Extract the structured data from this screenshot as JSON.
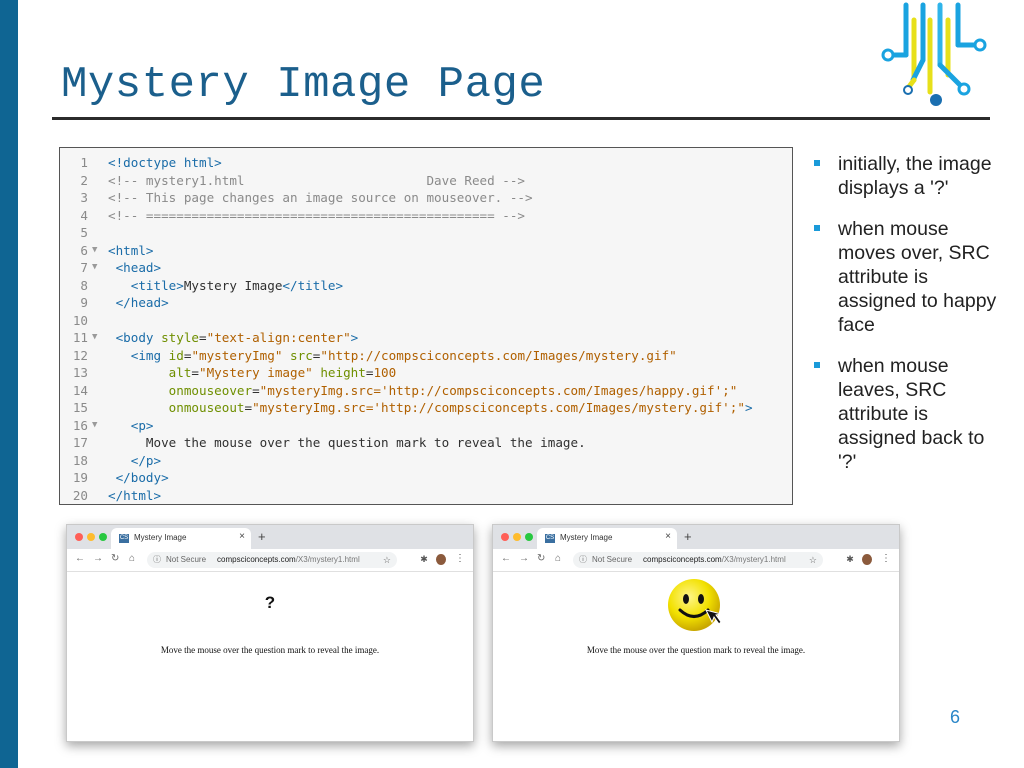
{
  "slide": {
    "title": "Mystery Image Page",
    "page_number": "6"
  },
  "code": {
    "lines": [
      {
        "n": "1",
        "fold": "",
        "parts": [
          [
            "tag",
            "<!doctype html>"
          ]
        ]
      },
      {
        "n": "2",
        "fold": "",
        "parts": [
          [
            "com",
            "<!-- mystery1.html                        Dave Reed -->"
          ]
        ]
      },
      {
        "n": "3",
        "fold": "",
        "parts": [
          [
            "com",
            "<!-- This page changes an image source on mouseover. -->"
          ]
        ]
      },
      {
        "n": "4",
        "fold": "",
        "parts": [
          [
            "com",
            "<!-- ============================================== -->"
          ]
        ]
      },
      {
        "n": "5",
        "fold": "",
        "parts": []
      },
      {
        "n": "6",
        "fold": "▼",
        "parts": [
          [
            "tag",
            "<html>"
          ]
        ]
      },
      {
        "n": "7",
        "fold": "▼",
        "parts": [
          [
            "txt",
            " "
          ],
          [
            "tag",
            "<head>"
          ]
        ]
      },
      {
        "n": "8",
        "fold": "",
        "parts": [
          [
            "txt",
            "   "
          ],
          [
            "tag",
            "<title>"
          ],
          [
            "txt",
            "Mystery Image"
          ],
          [
            "tag",
            "</title>"
          ]
        ]
      },
      {
        "n": "9",
        "fold": "",
        "parts": [
          [
            "txt",
            " "
          ],
          [
            "tag",
            "</head>"
          ]
        ]
      },
      {
        "n": "10",
        "fold": "",
        "parts": []
      },
      {
        "n": "11",
        "fold": "▼",
        "parts": [
          [
            "txt",
            " "
          ],
          [
            "tag",
            "<body "
          ],
          [
            "attr",
            "style"
          ],
          [
            "txt",
            "="
          ],
          [
            "str",
            "\"text-align:center\""
          ],
          [
            "tag",
            ">"
          ]
        ]
      },
      {
        "n": "12",
        "fold": "",
        "parts": [
          [
            "txt",
            "   "
          ],
          [
            "tag",
            "<img "
          ],
          [
            "attr",
            "id"
          ],
          [
            "txt",
            "="
          ],
          [
            "str",
            "\"mysteryImg\""
          ],
          [
            "txt",
            " "
          ],
          [
            "attr",
            "src"
          ],
          [
            "txt",
            "="
          ],
          [
            "str",
            "\"http://compsciconcepts.com/Images/mystery.gif\""
          ]
        ]
      },
      {
        "n": "13",
        "fold": "",
        "parts": [
          [
            "txt",
            "        "
          ],
          [
            "attr",
            "alt"
          ],
          [
            "txt",
            "="
          ],
          [
            "str",
            "\"Mystery image\""
          ],
          [
            "txt",
            " "
          ],
          [
            "attr",
            "height"
          ],
          [
            "txt",
            "="
          ],
          [
            "num",
            "100"
          ]
        ]
      },
      {
        "n": "14",
        "fold": "",
        "parts": [
          [
            "txt",
            "        "
          ],
          [
            "attr",
            "onmouseover"
          ],
          [
            "txt",
            "="
          ],
          [
            "str",
            "\"mysteryImg.src='http://compsciconcepts.com/Images/happy.gif';\""
          ]
        ]
      },
      {
        "n": "15",
        "fold": "",
        "parts": [
          [
            "txt",
            "        "
          ],
          [
            "attr",
            "onmouseout"
          ],
          [
            "txt",
            "="
          ],
          [
            "str",
            "\"mysteryImg.src='http://compsciconcepts.com/Images/mystery.gif';\""
          ],
          [
            "tag",
            ">"
          ]
        ]
      },
      {
        "n": "16",
        "fold": "▼",
        "parts": [
          [
            "txt",
            "   "
          ],
          [
            "tag",
            "<p>"
          ]
        ]
      },
      {
        "n": "17",
        "fold": "",
        "parts": [
          [
            "txt",
            "     Move the mouse over the question mark to reveal the image."
          ]
        ]
      },
      {
        "n": "18",
        "fold": "",
        "parts": [
          [
            "txt",
            "   "
          ],
          [
            "tag",
            "</p>"
          ]
        ]
      },
      {
        "n": "19",
        "fold": "",
        "parts": [
          [
            "txt",
            " "
          ],
          [
            "tag",
            "</body>"
          ]
        ]
      },
      {
        "n": "20",
        "fold": "",
        "parts": [
          [
            "tag",
            "</html>"
          ]
        ]
      }
    ]
  },
  "bullets": [
    "initially, the image displays a '?'",
    "when mouse moves over, SRC attribute is assigned to happy face",
    "when mouse leaves, SRC attribute is assigned back to '?'"
  ],
  "browser": {
    "tab_title": "Mystery Image",
    "tab_favicon": "CS",
    "new_tab": "+",
    "tab_close": "×",
    "not_secure": "Not Secure",
    "host": "compsciconcepts.com",
    "path": "/X3/mystery1.html",
    "page_text": "Move the mouse over the question mark to reveal the image.",
    "question_mark": "?"
  },
  "colors": {
    "accent": "#0f6593",
    "title": "#1b5f8c",
    "bullet": "#1a9ad9"
  }
}
